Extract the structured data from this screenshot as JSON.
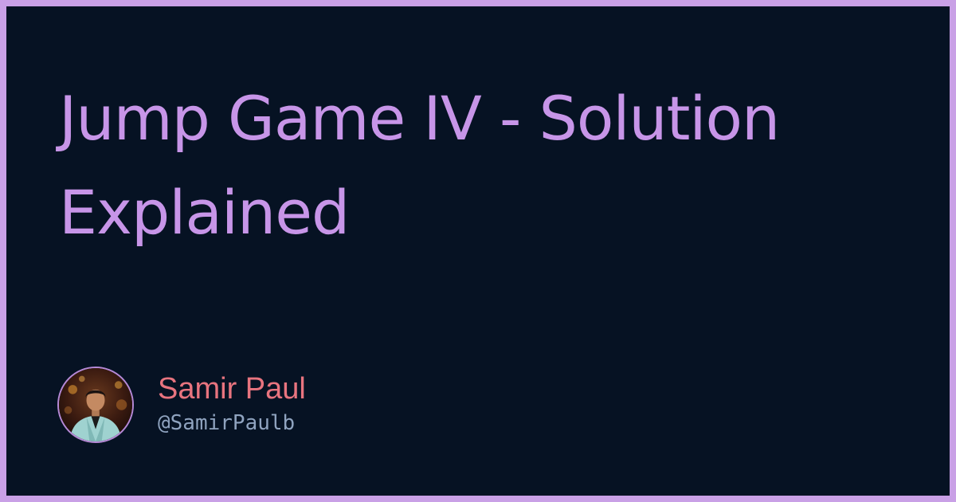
{
  "post": {
    "title": "Jump Game IV - Solution Explained"
  },
  "author": {
    "name": "Samir Paul",
    "handle": "@SamirPaulb",
    "avatar_icon": "person-photo-avatar"
  },
  "colors": {
    "frame": "#c9a0e6",
    "background": "#061223",
    "title": "#c795e8",
    "author_name": "#e8747f",
    "author_handle": "#8fa3bf"
  }
}
